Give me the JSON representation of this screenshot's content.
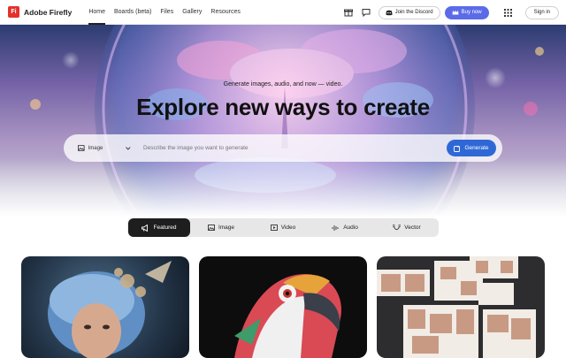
{
  "brand": {
    "name": "Adobe Firefly",
    "mark": "Fi"
  },
  "nav": {
    "items": [
      "Home",
      "Boards (beta)",
      "Files",
      "Gallery",
      "Resources"
    ],
    "active": 0
  },
  "header_actions": {
    "discord": "Join the Discord",
    "buy": "Buy now",
    "signin": "Sign in"
  },
  "hero": {
    "subtitle": "Generate images, audio, and now — video.",
    "title": "Explore new ways to create",
    "media_type": "Image",
    "prompt_placeholder": "Describe the image you want to generate",
    "generate_label": "Generate"
  },
  "tabs": [
    {
      "label": "Featured",
      "icon": "megaphone-icon",
      "active": true
    },
    {
      "label": "Image",
      "icon": "image-icon",
      "active": false
    },
    {
      "label": "Video",
      "icon": "video-icon",
      "active": false
    },
    {
      "label": "Audio",
      "icon": "audio-icon",
      "active": false
    },
    {
      "label": "Vector",
      "icon": "vector-icon",
      "active": false
    }
  ],
  "colors": {
    "brand_red": "#e4312b",
    "buy_button": "#5b6be8",
    "generate_button": "#2f68d6",
    "active_tab": "#1e1e1e"
  }
}
